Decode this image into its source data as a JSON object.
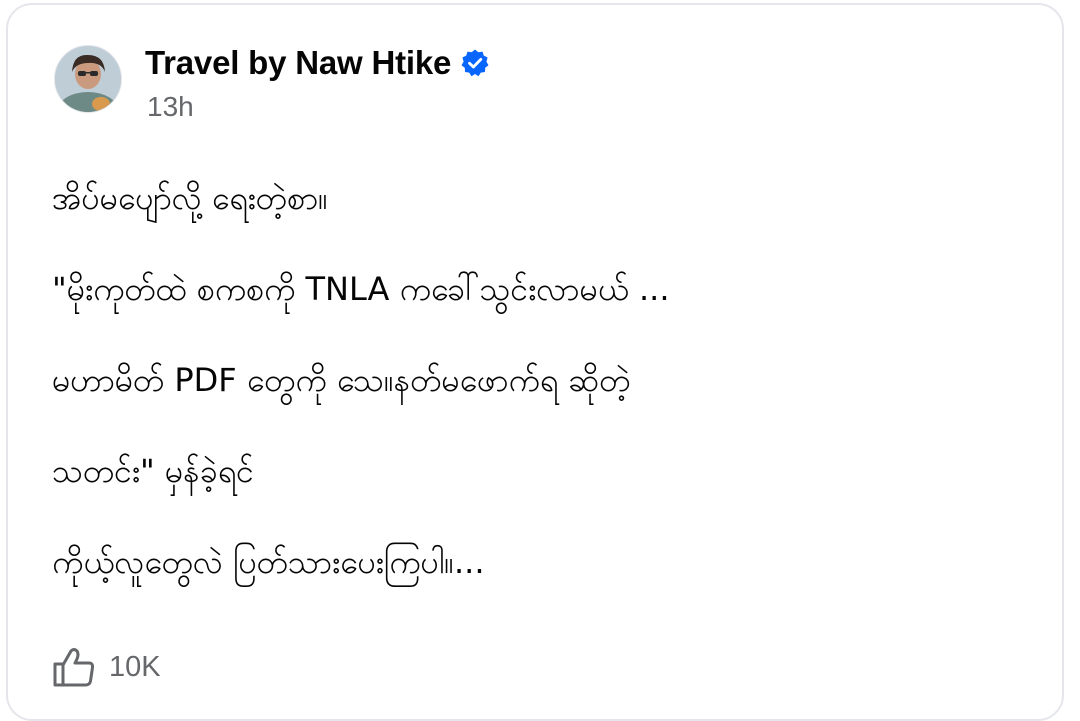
{
  "post": {
    "author": "Travel by Naw Htike",
    "verified_icon": "verified-badge-icon",
    "timestamp": "13h",
    "lines": [
      "အိပ်မပျော်လို့ ရေးတဲ့စာ။",
      "\"မိုးကုတ်ထဲ စကစကို TNLA ကခေါ်သွင်းလာမယ် ...",
      "မဟာမိတ် PDF တွေကို သေ။နတ်မဖောက်ရ ဆိုတဲ့",
      "သတင်း\" မှန်ခဲ့ရင်",
      "ကိုယ့်လူတွေလဲ ပြတ်သားပေးကြပါ။..."
    ]
  },
  "reactions": {
    "icon": "thumbs-up-icon",
    "count": "10K"
  },
  "colors": {
    "verified_blue": "#0866ff",
    "secondary_text": "#65676b",
    "card_border": "#e4e6eb"
  }
}
